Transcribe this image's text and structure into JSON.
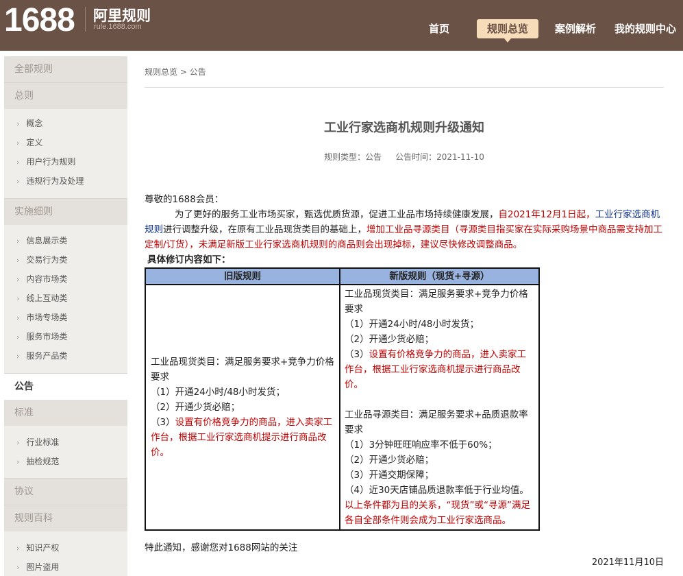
{
  "header": {
    "logo_number": "1688",
    "logo_title": "阿里规则",
    "logo_domain": "rule.1688.com",
    "nav": [
      {
        "label": "首页",
        "active": false
      },
      {
        "label": "规则总览",
        "active": true
      },
      {
        "label": "案例解析",
        "active": false
      },
      {
        "label": "我的规则中心",
        "active": false
      }
    ]
  },
  "sidebar": {
    "all_rules": "全部规则",
    "general": {
      "label": "总则",
      "items": [
        "概念",
        "定义",
        "用户行为规则",
        "违规行为及处理"
      ]
    },
    "implementation": {
      "label": "实施细则",
      "items": [
        "信息展示类",
        "交易行为类",
        "内容市场类",
        "线上互动类",
        "市场专场类",
        "服务市场类",
        "服务产品类"
      ]
    },
    "announcement": "公告",
    "standard": {
      "label": "标准",
      "items": [
        "行业标准",
        "抽检规范"
      ]
    },
    "agreement": "协议",
    "encyclopedia": {
      "label": "规则百科",
      "items": [
        "知识产权",
        "图片盗用"
      ]
    }
  },
  "breadcrumb": {
    "root": "规则总览",
    "sep": ">",
    "current": "公告"
  },
  "article": {
    "title": "工业行家选商机规则升级通知",
    "meta_type_label": "规则类型：",
    "meta_type": "公告",
    "meta_time_label": "公告时间：",
    "meta_time": "2021-11-10",
    "greeting": "尊敬的1688会员：",
    "intro_1": "为了更好的服务工业市场买家，甄选优质货源，促进工业品市场持续健康发展，",
    "intro_red_1": "自2021年12月1日起，",
    "intro_blue": "工业行家选商机规则",
    "intro_2": "进行调整升级，在原有工业品现货类目的基础上，",
    "intro_red_2": "增加工业品寻源类目（寻源类目指买家在实际采购场景中商品需支持加工定制/订货），未满足新版工业行家选商机规则的商品则会出现掉标，建议尽快修改调整商品。",
    "section_heading": "具体修订内容如下：",
    "table": {
      "col_old": "旧版规则",
      "col_new": "新版规则（现货+寻源）",
      "old": {
        "heading": "工业品现货类目：满足服务要求+竞争力价格要求",
        "l1": "（1）开通24小时/48小时发货；",
        "l2": "（2）开通少货必赔；",
        "l3_prefix": "（3）",
        "l3_red": "设置有价格竞争力的商品，进入卖家工作台，根据工业行家选商机提示进行商品改价。"
      },
      "new_spot": {
        "heading": "工业品现货类目：满足服务要求+竞争力价格要求",
        "l1": "（1）开通24小时/48小时发货；",
        "l2": "（2）开通少货必赔；",
        "l3_prefix": "（3）",
        "l3_red": "设置有价格竞争力的商品，进入卖家工作台，根据工业行家选商机提示进行商品改价。"
      },
      "new_source": {
        "heading": "工业品寻源类目：满足服务要求+品质退款率要求",
        "l1": "（1）3分钟旺旺响应率不低于60%；",
        "l2": "（2）开通少货必赔；",
        "l3": "（3）开通交期保障；",
        "l4": "（4）近30天店铺品质退款率低于行业均值。",
        "note_red": "以上条件都为且的关系，“现货”或“寻源”满足各自全部条件则会成为工业行家选商品。"
      }
    },
    "closing": "特此通知，感谢您对1688网站的关注",
    "date": "2021年11月10日"
  }
}
